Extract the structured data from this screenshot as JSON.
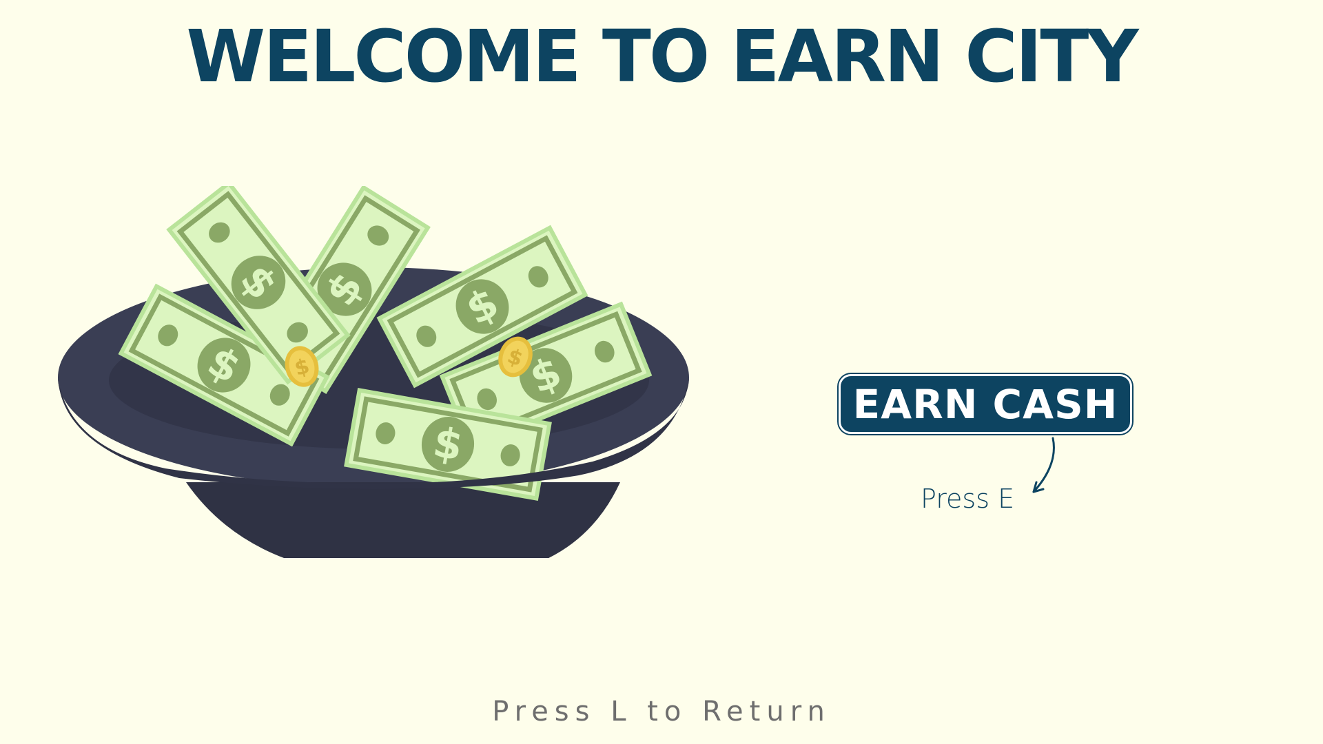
{
  "title": "WELCOME TO EARN CITY",
  "earn_button": {
    "label": "EARN CASH"
  },
  "hint": {
    "label": "Press E"
  },
  "footer": {
    "label": "Press L to Return"
  },
  "illustration": {
    "name": "money-bowl",
    "icons": [
      "dollar-bill-icon",
      "gold-coin-icon"
    ]
  },
  "colors": {
    "background": "#fefeeb",
    "title": "#0d4461",
    "button": "#0d4461",
    "bowl": "#3a3e54",
    "bill_light": "#dcf5c0",
    "bill_dark": "#8aa866",
    "coin": "#f2d35c",
    "footer": "#6e6e6e"
  }
}
